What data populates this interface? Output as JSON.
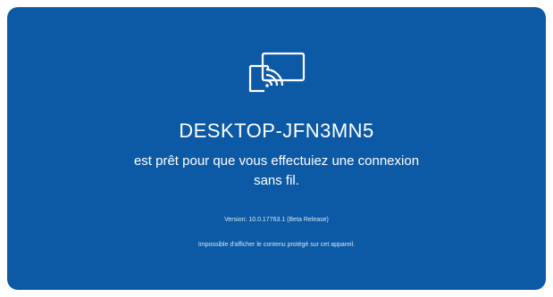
{
  "screen": {
    "background_color": "#0c5aa6",
    "icon": "wireless-display-cast-icon",
    "device_name": "DESKTOP-JFN3MN5",
    "message_line1": "est prêt pour que vous effectuiez une connexion",
    "message_line2": "sans fil.",
    "version": "Version: 10.0.17763.1 (Beta Release)",
    "protected_notice": "Impossible d'afficher le contenu protégé sur cet appareil."
  }
}
